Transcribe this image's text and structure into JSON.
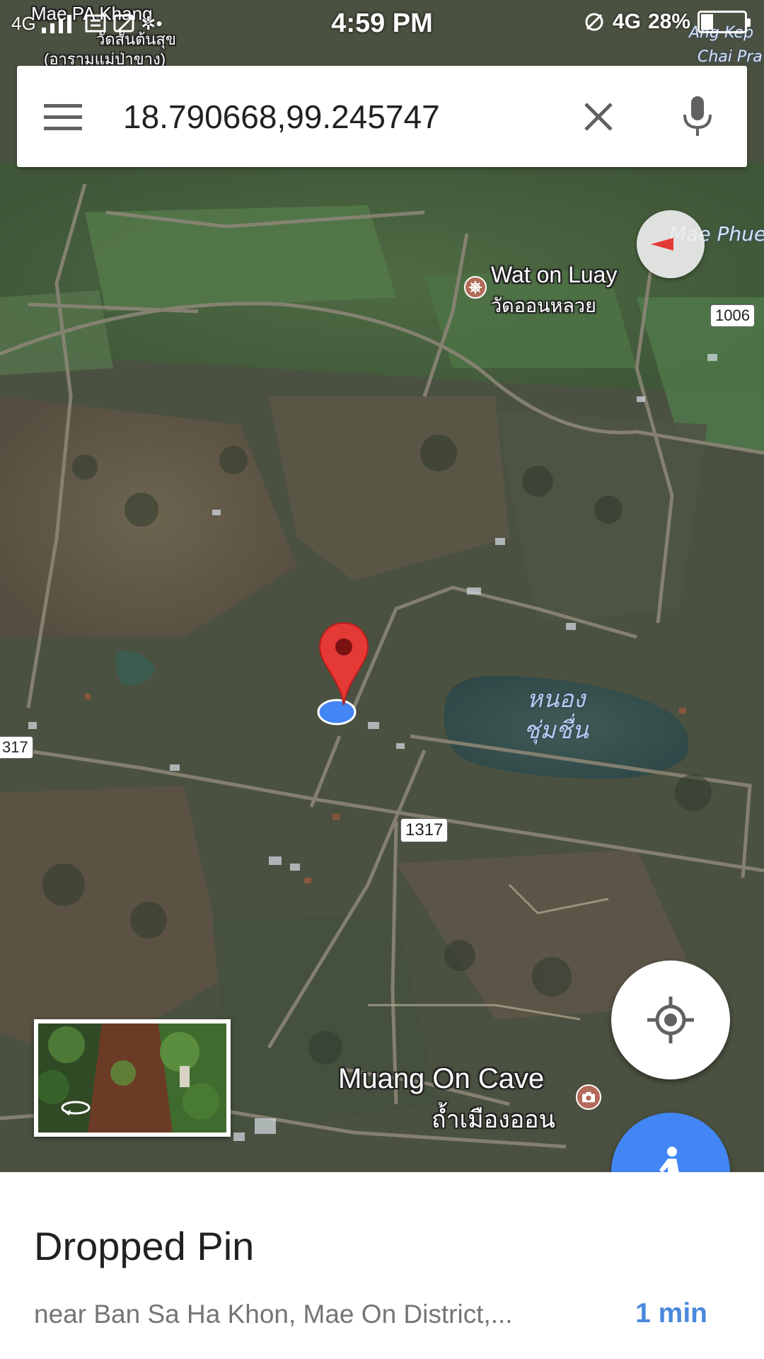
{
  "status_bar": {
    "network_left": "4G",
    "time": "4:59 PM",
    "network_right": "4G",
    "battery": "28%",
    "battery_level": 0.28
  },
  "search": {
    "value": "18.790668,99.245747",
    "menu_icon": "hamburger-menu-icon",
    "clear_icon": "close-icon",
    "voice_icon": "microphone-icon"
  },
  "map": {
    "labels": {
      "mae_pa_khang": "Mae PA Khang",
      "wat_top_thai": "วัดสันต้นสุข",
      "aram": "(อารามแม่ป่าขาง)",
      "wat_on_luay": "Wat on Luay",
      "wat_on_luay_thai": "วัดออนหลวย",
      "muang_on_cave": "Muang On Cave",
      "muang_on_cave_thai": "ถ้ำเมืองออน",
      "mae_phue": "Mae Phue",
      "ang_kep": "Ang Kep",
      "chai_pra": "Chai Pra",
      "lake_line1": "หนอง",
      "lake_line2": "ชุ่มชื่น"
    },
    "road_shields": {
      "r1006": "1006",
      "r1317": "1317",
      "r317": "317"
    },
    "colors": {
      "pin": "#e53935",
      "location_dot": "#4285f4",
      "fab_blue": "#4285f4"
    }
  },
  "bottom_sheet": {
    "title": "Dropped Pin",
    "address": "near Ban Sa Ha Khon, Mae On District,...",
    "eta": "1 min"
  }
}
